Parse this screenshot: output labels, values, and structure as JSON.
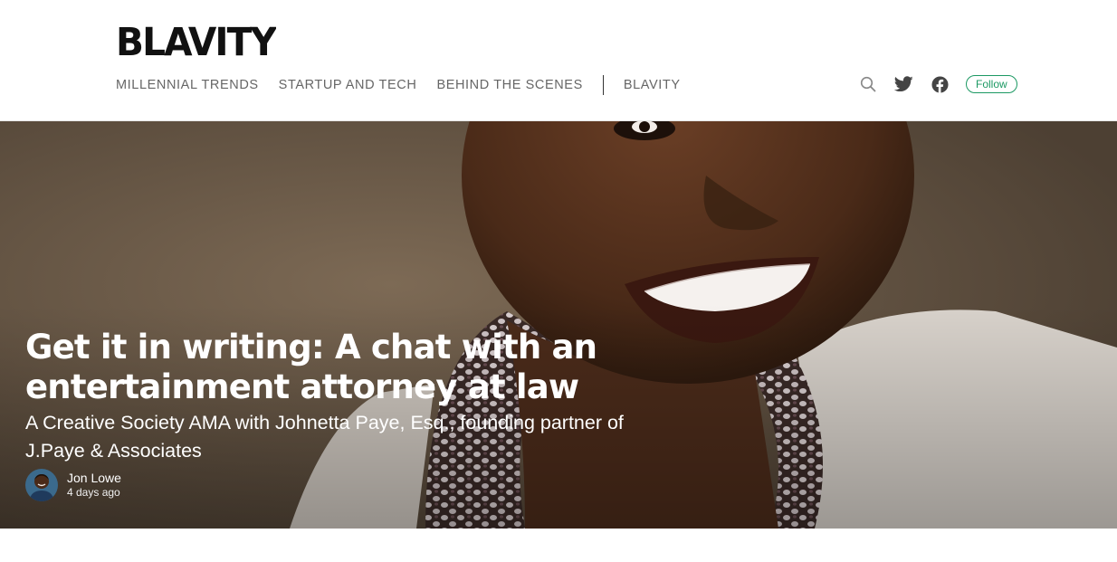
{
  "site": {
    "logo_text": "BLAVITY",
    "logo_icon": "blavity-wordmark"
  },
  "nav": {
    "items": [
      {
        "label": "MILLENNIAL TRENDS"
      },
      {
        "label": "STARTUP AND TECH"
      },
      {
        "label": "BEHIND THE SCENES"
      }
    ],
    "home_label": "BLAVITY"
  },
  "actions": {
    "search_icon": "search-icon",
    "twitter_icon": "twitter-icon",
    "facebook_icon": "facebook-icon",
    "follow_label": "Follow"
  },
  "article": {
    "title": "Get it in writing: A chat with an entertainment attorney at law",
    "subtitle": "A Creative Society AMA with Johnetta Paye, Esq., founding partner of J.Paye & Associates",
    "author": "Jon Lowe",
    "posted": "4 days ago"
  },
  "colors": {
    "accent": "#1c9963",
    "nav_text": "#666666",
    "hero_bg": "#5e4f40"
  }
}
